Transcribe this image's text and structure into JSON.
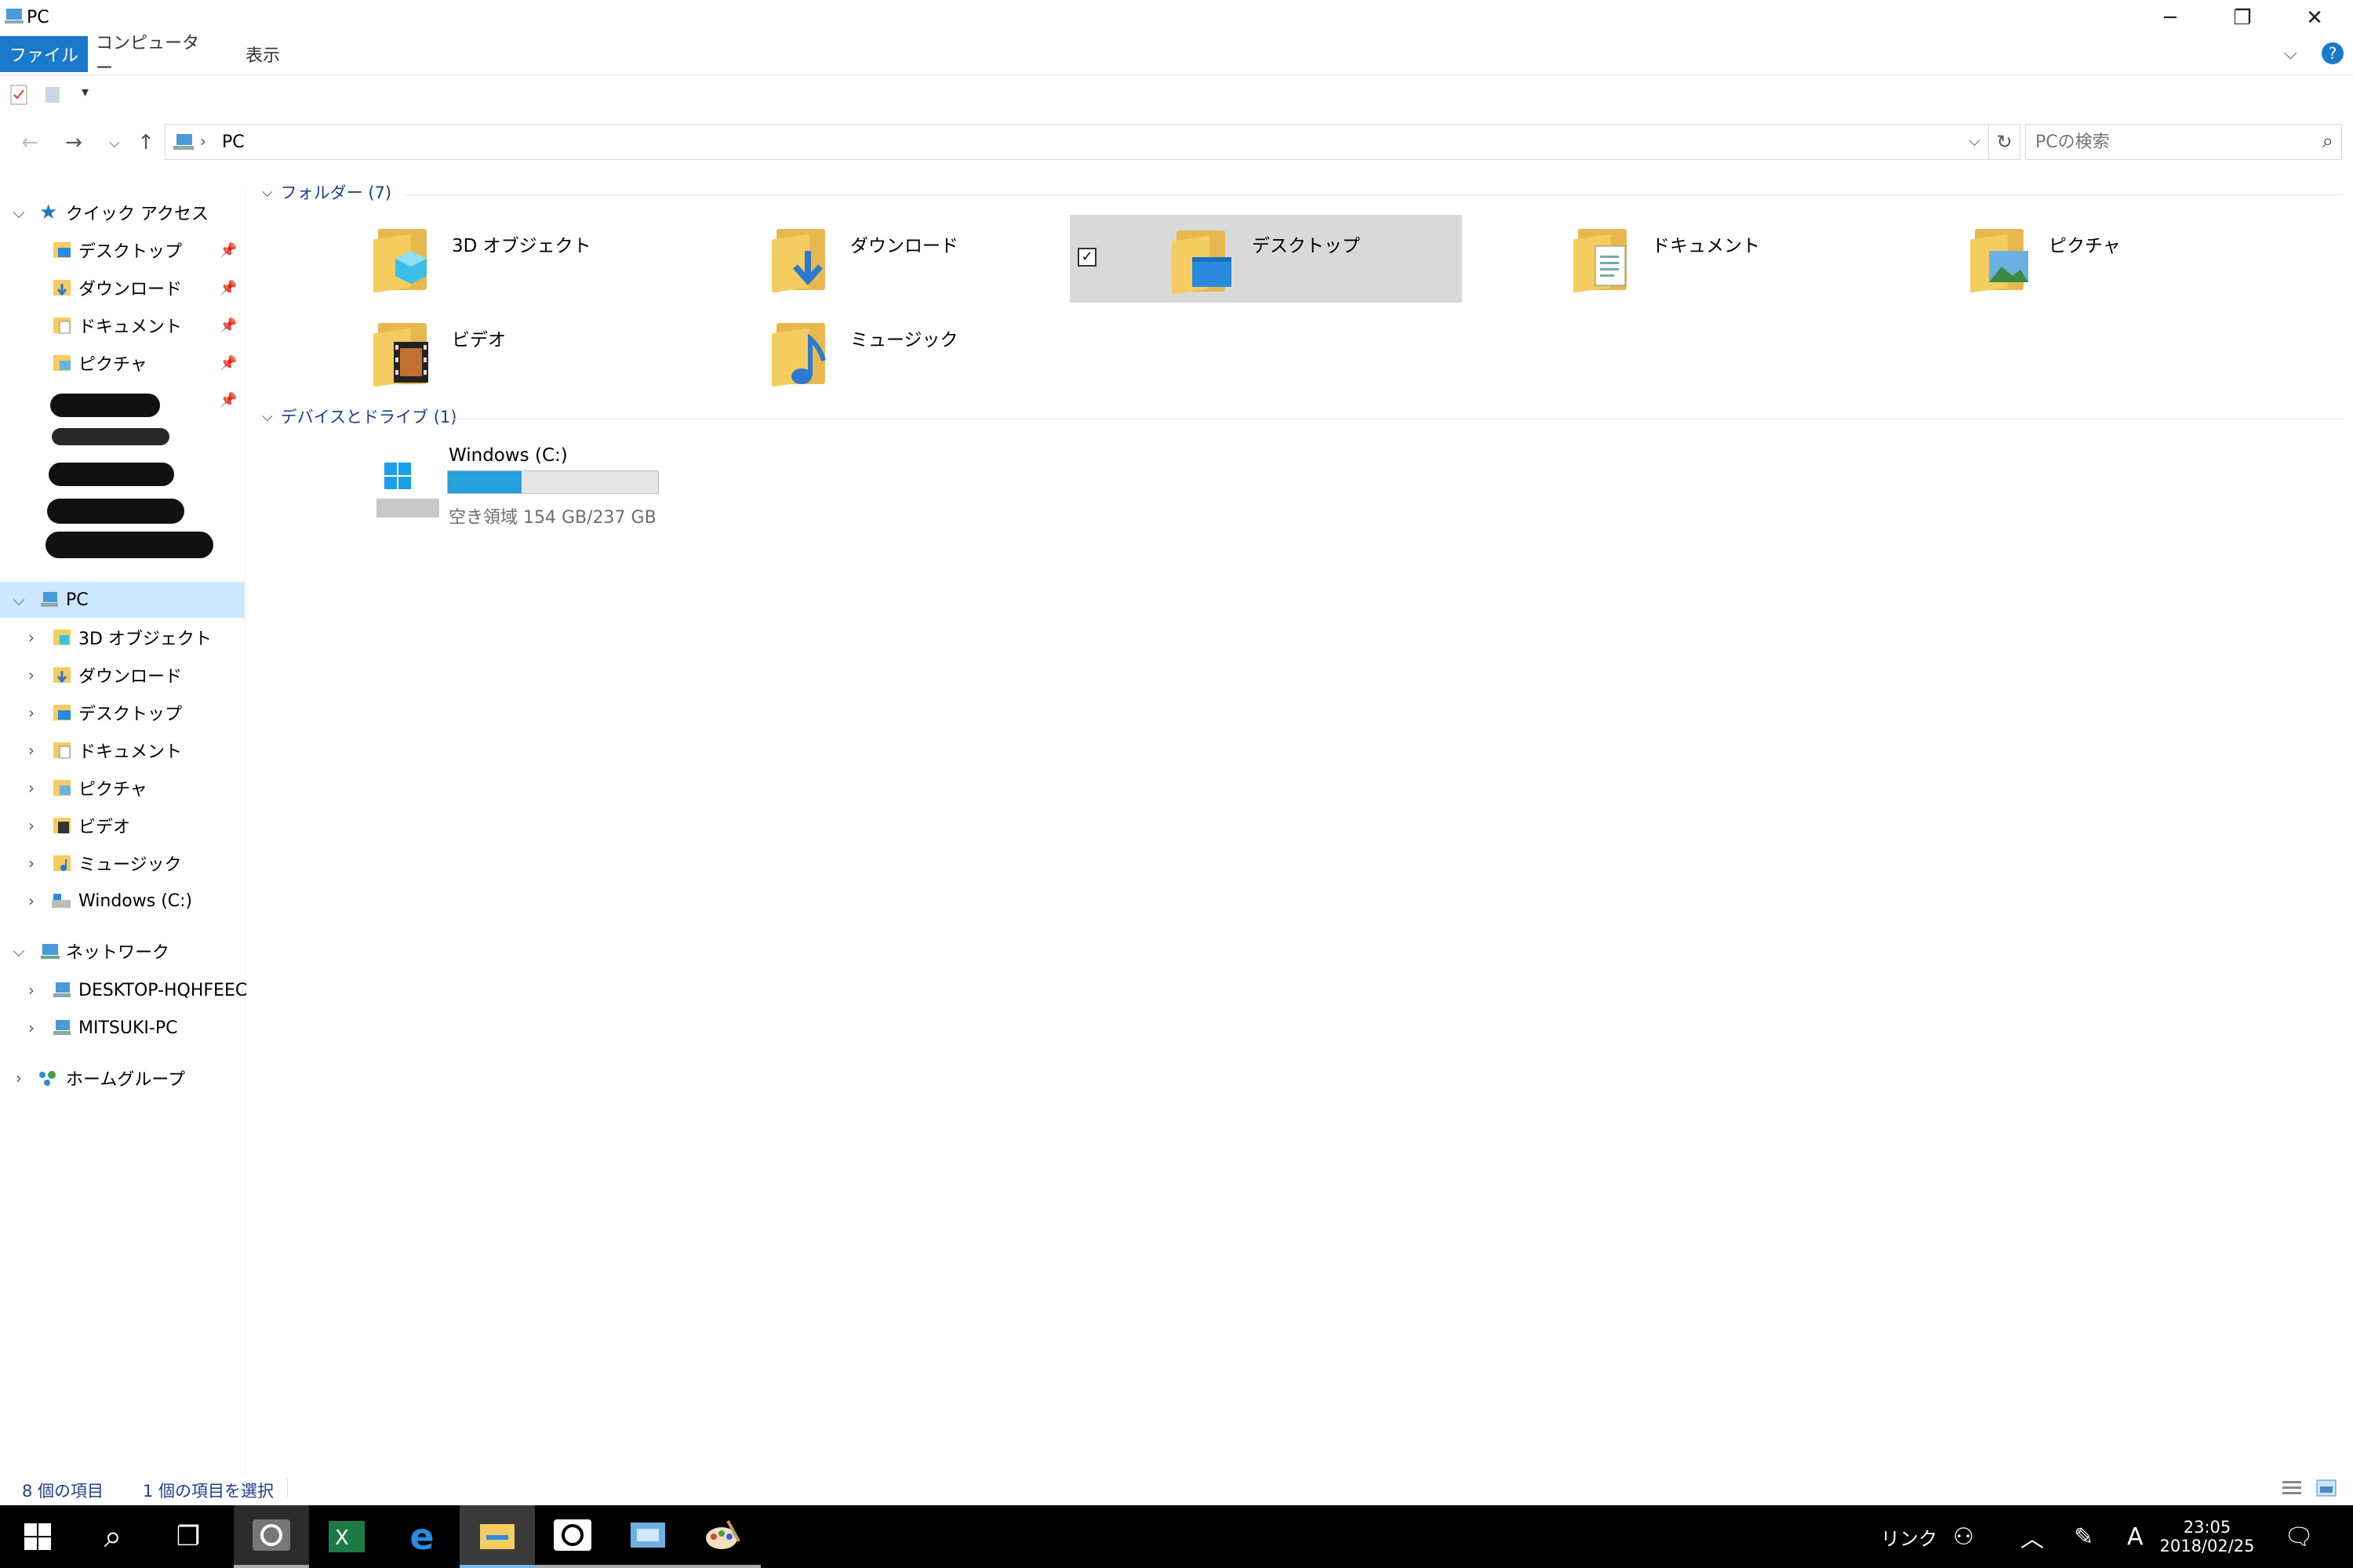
{
  "window": {
    "title": "PC"
  },
  "ribbon": {
    "tabs": [
      "ファイル",
      "コンピューター",
      "表示"
    ]
  },
  "address": {
    "location": "PC"
  },
  "search": {
    "placeholder": "PCの検索"
  },
  "nav": {
    "quick_access": {
      "label": "クイック アクセス",
      "items": [
        "デスクトップ",
        "ダウンロード",
        "ドキュメント",
        "ピクチャ"
      ]
    },
    "pc": {
      "label": "PC",
      "items": [
        "3D オブジェクト",
        "ダウンロード",
        "デスクトップ",
        "ドキュメント",
        "ピクチャ",
        "ビデオ",
        "ミュージック",
        "Windows (C:)"
      ]
    },
    "network": {
      "label": "ネットワーク",
      "items": [
        "DESKTOP-HQHFEEC",
        "MITSUKI-PC"
      ]
    },
    "homegroup": {
      "label": "ホームグループ"
    }
  },
  "content": {
    "folders_header": "フォルダー (7)",
    "folders": [
      "3D オブジェクト",
      "ダウンロード",
      "デスクトップ",
      "ドキュメント",
      "ピクチャ",
      "ビデオ",
      "ミュージック"
    ],
    "selected_folder": "デスクトップ",
    "drives_header": "デバイスとドライブ (1)",
    "drive": {
      "name": "Windows (C:)",
      "free_text": "空き領域 154 GB/237 GB",
      "used_fraction": 0.35
    }
  },
  "status": {
    "item_count": "8 個の項目",
    "selection": "1 個の項目を選択"
  },
  "taskbar": {
    "link_label": "リンク",
    "ime": "A",
    "time": "23:05",
    "date": "2018/02/25"
  },
  "colors": {
    "accent": "#1979ca",
    "selection": "#d9d9d9",
    "drive_bar": "#26a0da",
    "nav_selected": "#cce8ff"
  }
}
